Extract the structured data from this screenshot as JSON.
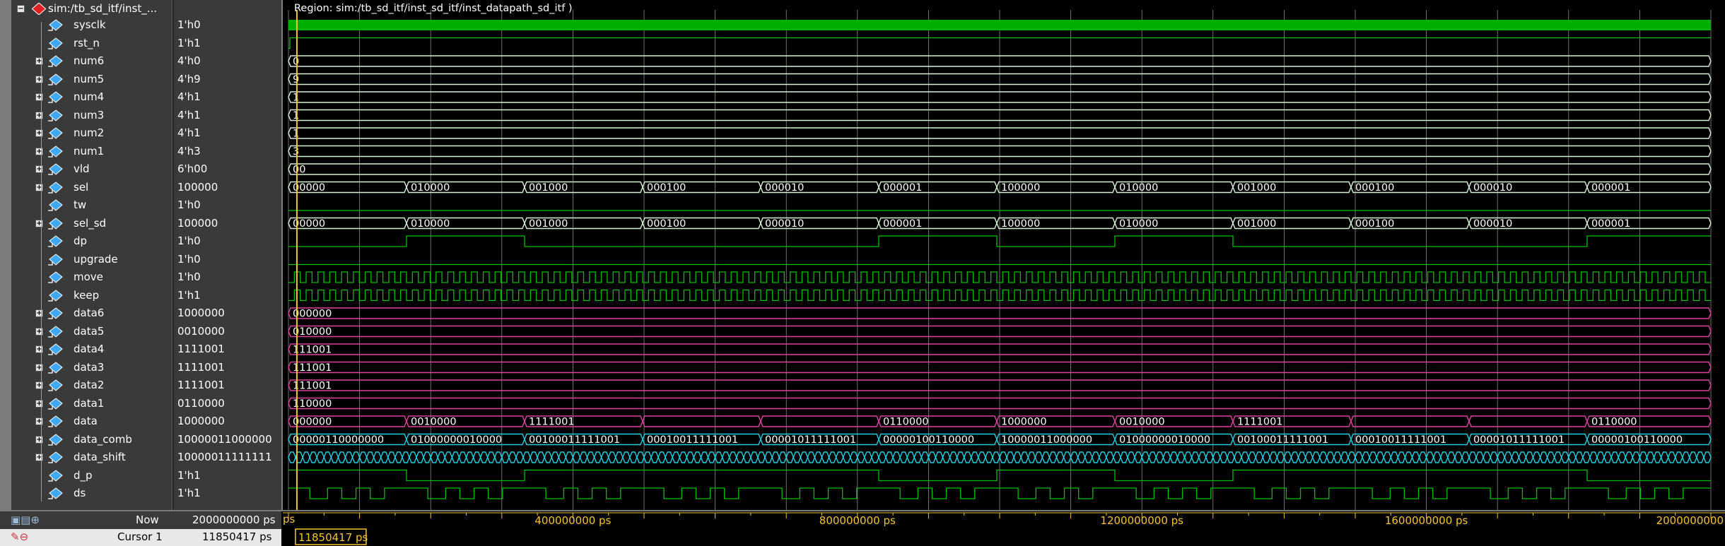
{
  "region_label": "Region: sim:/tb_sd_itf/inst_sd_itf/inst_datapath_sd_itf )",
  "root_label": "sim:/tb_sd_itf/inst_...",
  "colors": {
    "clock": "#00b000",
    "logic": "#00c000",
    "bus": "#d8f0d8",
    "data": "#e040a0",
    "shift": "#20d0e0"
  },
  "signals": [
    {
      "name": "sysclk",
      "value": "1'h0",
      "expandable": false
    },
    {
      "name": "rst_n",
      "value": "1'h1",
      "expandable": false
    },
    {
      "name": "num6",
      "value": "4'h0",
      "expandable": true
    },
    {
      "name": "num5",
      "value": "4'h9",
      "expandable": true
    },
    {
      "name": "num4",
      "value": "4'h1",
      "expandable": true
    },
    {
      "name": "num3",
      "value": "4'h1",
      "expandable": true
    },
    {
      "name": "num2",
      "value": "4'h1",
      "expandable": true
    },
    {
      "name": "num1",
      "value": "4'h3",
      "expandable": true
    },
    {
      "name": "vld",
      "value": "6'h00",
      "expandable": true
    },
    {
      "name": "sel",
      "value": "100000",
      "expandable": true
    },
    {
      "name": "tw",
      "value": "1'h0",
      "expandable": false
    },
    {
      "name": "sel_sd",
      "value": "100000",
      "expandable": true
    },
    {
      "name": "dp",
      "value": "1'h0",
      "expandable": false
    },
    {
      "name": "upgrade",
      "value": "1'h0",
      "expandable": false
    },
    {
      "name": "move",
      "value": "1'h0",
      "expandable": false
    },
    {
      "name": "keep",
      "value": "1'h1",
      "expandable": false
    },
    {
      "name": "data6",
      "value": "1000000",
      "expandable": true
    },
    {
      "name": "data5",
      "value": "0010000",
      "expandable": true
    },
    {
      "name": "data4",
      "value": "1111001",
      "expandable": true
    },
    {
      "name": "data3",
      "value": "1111001",
      "expandable": true
    },
    {
      "name": "data2",
      "value": "1111001",
      "expandable": true
    },
    {
      "name": "data1",
      "value": "0110000",
      "expandable": true
    },
    {
      "name": "data",
      "value": "1000000",
      "expandable": true
    },
    {
      "name": "data_comb",
      "value": "10000011000000",
      "expandable": true
    },
    {
      "name": "data_shift",
      "value": "10000011111111",
      "expandable": true
    },
    {
      "name": "d_p",
      "value": "1'h1",
      "expandable": false
    },
    {
      "name": "ds",
      "value": "1'h1",
      "expandable": false
    }
  ],
  "wave_labels": {
    "num6": "0",
    "num5": "9",
    "num4": "1",
    "num3": "1",
    "num2": "1",
    "num1": "3",
    "vld": "00",
    "sel": [
      "00000",
      "010000",
      "001000",
      "000100",
      "000010",
      "000001",
      "100000",
      "010000",
      "001000",
      "000100",
      "000010",
      "000001"
    ],
    "sel_sd": [
      "00000",
      "010000",
      "001000",
      "000100",
      "000010",
      "000001",
      "100000",
      "010000",
      "001000",
      "000100",
      "000010",
      "000001"
    ],
    "data6": "000000",
    "data5": "010000",
    "data4": "111001",
    "data3": "111001",
    "data2": "111001",
    "data1": "110000",
    "data": [
      "000000",
      "0010000",
      "1111001",
      "",
      "",
      "0110000",
      "1000000",
      "0010000",
      "1111001",
      "",
      "",
      "0110000"
    ],
    "data_comb": [
      "00000110000000",
      "01000000010000",
      "00100011111001",
      "00010011111001",
      "00001011111001",
      "00000100110000",
      "10000011000000",
      "01000000010000",
      "00100011111001",
      "00010011111001",
      "00001011111001",
      "00000100110000"
    ]
  },
  "status": {
    "now_label": "Now",
    "now_value": "2000000000 ps",
    "cursor_label": "Cursor 1",
    "cursor_value": "11850417 ps",
    "cursor_flag": "11850417 ps",
    "cursor_time_ps": 11850417,
    "sim_end_ps": 2000000000,
    "ruler_ticks": [
      "400000000 ps",
      "800000000 ps",
      "1200000000 ps",
      "1600000000 ps",
      "2000000000"
    ],
    "ruler_zero": "ps"
  }
}
